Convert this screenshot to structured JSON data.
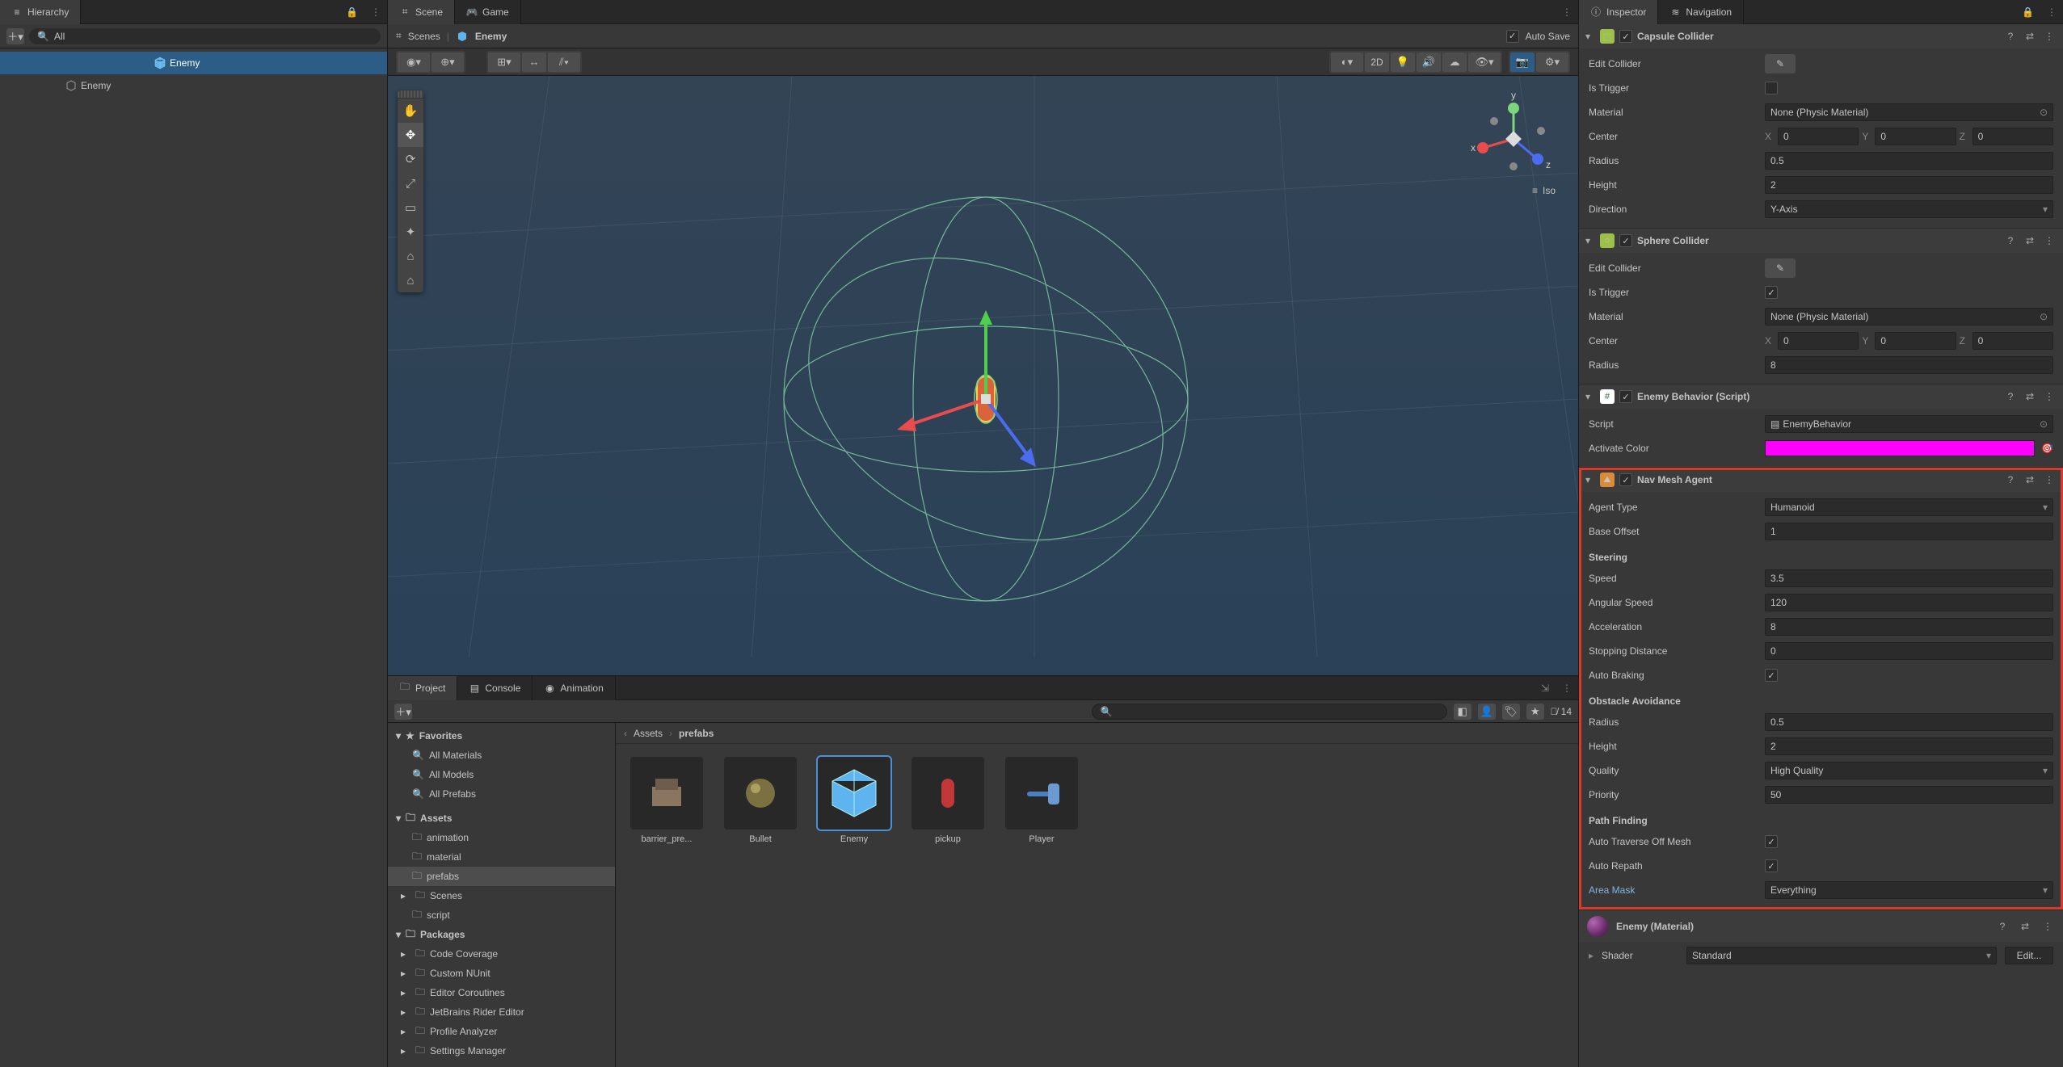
{
  "hierarchy": {
    "tab": "Hierarchy",
    "searchPlaceholder": "All",
    "root": "Enemy",
    "child": "Enemy"
  },
  "scene": {
    "tabScene": "Scene",
    "tabGame": "Game",
    "autoSave": "Auto Save",
    "breadcrumb1": "Scenes",
    "breadcrumb2": "Enemy",
    "twoD": "2D",
    "isoLabel": "Iso",
    "axis_x": "x",
    "axis_y": "y",
    "axis_z": "z"
  },
  "project": {
    "tabProject": "Project",
    "tabConsole": "Console",
    "tabAnimation": "Animation",
    "hiddenCount": "14",
    "breadcrumb1": "Assets",
    "breadcrumb2": "prefabs",
    "favorites": "Favorites",
    "favItems": [
      "All Materials",
      "All Models",
      "All Prefabs"
    ],
    "assetsLabel": "Assets",
    "assetFolders": [
      "animation",
      "material",
      "prefabs",
      "Scenes",
      "script"
    ],
    "packagesLabel": "Packages",
    "packages": [
      "Code Coverage",
      "Custom NUnit",
      "Editor Coroutines",
      "JetBrains Rider Editor",
      "Profile Analyzer",
      "Settings Manager"
    ],
    "assets": [
      {
        "name": "barrier_pre...",
        "type": "prefab"
      },
      {
        "name": "Bullet",
        "type": "sphere"
      },
      {
        "name": "Enemy",
        "type": "cube"
      },
      {
        "name": "pickup",
        "type": "capsule"
      },
      {
        "name": "Player",
        "type": "hammer"
      }
    ]
  },
  "inspector": {
    "tabInspector": "Inspector",
    "tabNavigation": "Navigation",
    "capsule": {
      "title": "Capsule Collider",
      "editCollider": "Edit Collider",
      "isTrigger": "Is Trigger",
      "material": "Material",
      "materialVal": "None (Physic Material)",
      "center": "Center",
      "cx": "0",
      "cy": "0",
      "cz": "0",
      "radius": "Radius",
      "radiusVal": "0.5",
      "height": "Height",
      "heightVal": "2",
      "direction": "Direction",
      "directionVal": "Y-Axis"
    },
    "sphere": {
      "title": "Sphere Collider",
      "editCollider": "Edit Collider",
      "isTrigger": "Is Trigger",
      "material": "Material",
      "materialVal": "None (Physic Material)",
      "center": "Center",
      "cx": "0",
      "cy": "0",
      "cz": "0",
      "radius": "Radius",
      "radiusVal": "8"
    },
    "script": {
      "title": "Enemy Behavior (Script)",
      "scriptLabel": "Script",
      "scriptVal": "EnemyBehavior",
      "activateColor": "Activate Color"
    },
    "nav": {
      "title": "Nav Mesh Agent",
      "agentType": "Agent Type",
      "agentTypeVal": "Humanoid",
      "baseOffset": "Base Offset",
      "baseOffsetVal": "1",
      "steering": "Steering",
      "speed": "Speed",
      "speedVal": "3.5",
      "angularSpeed": "Angular Speed",
      "angularSpeedVal": "120",
      "acceleration": "Acceleration",
      "accelerationVal": "8",
      "stoppingDistance": "Stopping Distance",
      "stoppingDistanceVal": "0",
      "autoBraking": "Auto Braking",
      "obstacle": "Obstacle Avoidance",
      "radius": "Radius",
      "radiusVal": "0.5",
      "height": "Height",
      "heightVal": "2",
      "quality": "Quality",
      "qualityVal": "High Quality",
      "priority": "Priority",
      "priorityVal": "50",
      "pathFinding": "Path Finding",
      "autoTraverse": "Auto Traverse Off Mesh",
      "autoRepath": "Auto Repath",
      "areaMask": "Area Mask",
      "areaMaskVal": "Everything"
    },
    "material": {
      "title": "Enemy (Material)",
      "shader": "Shader",
      "shaderVal": "Standard",
      "editBtn": "Edit..."
    },
    "axisX": "X",
    "axisY": "Y",
    "axisZ": "Z"
  }
}
